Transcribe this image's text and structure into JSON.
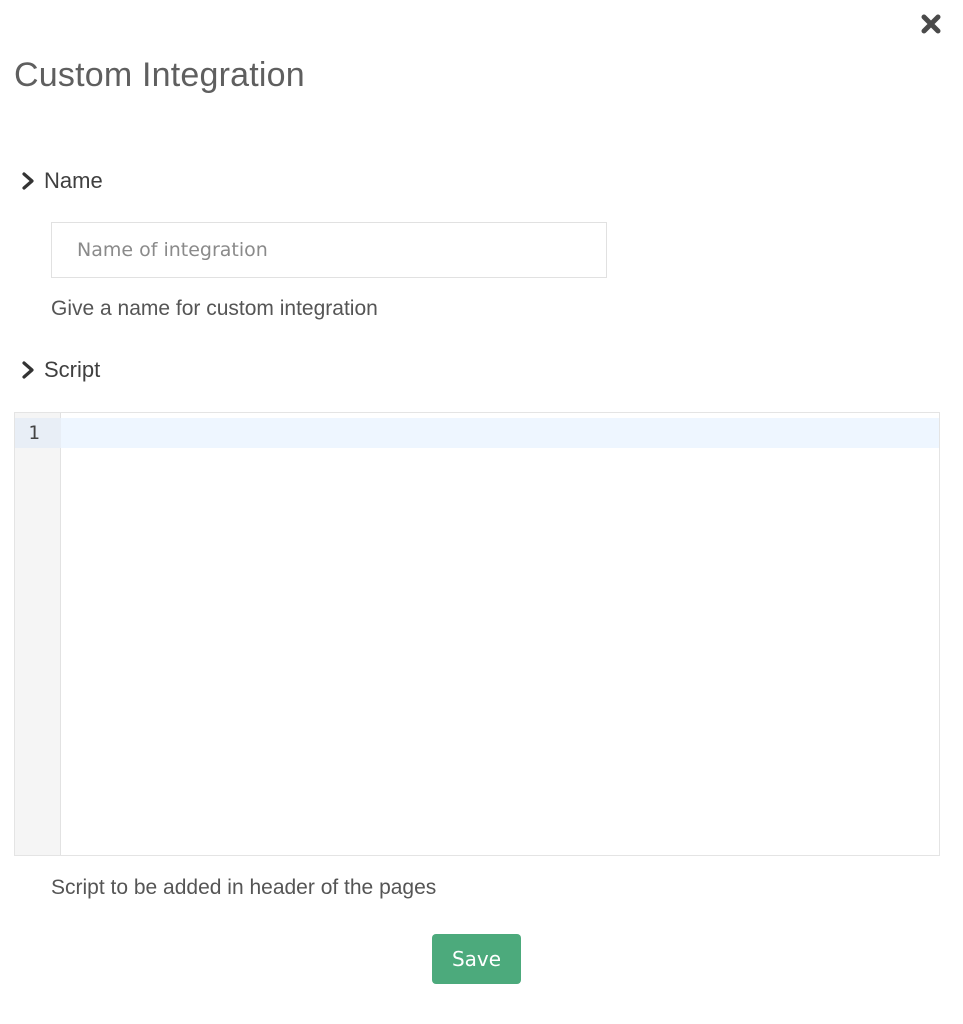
{
  "dialog": {
    "title": "Custom Integration",
    "close_icon": "close-icon"
  },
  "name_section": {
    "label": "Name",
    "input_placeholder": "Name of integration",
    "input_value": "",
    "help_text": "Give a name for custom integration"
  },
  "script_section": {
    "label": "Script",
    "line_numbers": [
      "1"
    ],
    "help_text": "Script to be added in header of the pages"
  },
  "actions": {
    "save_label": "Save"
  },
  "colors": {
    "primary": "#4caa7c",
    "active_line": "#eef6ff",
    "gutter": "#f5f5f5"
  }
}
